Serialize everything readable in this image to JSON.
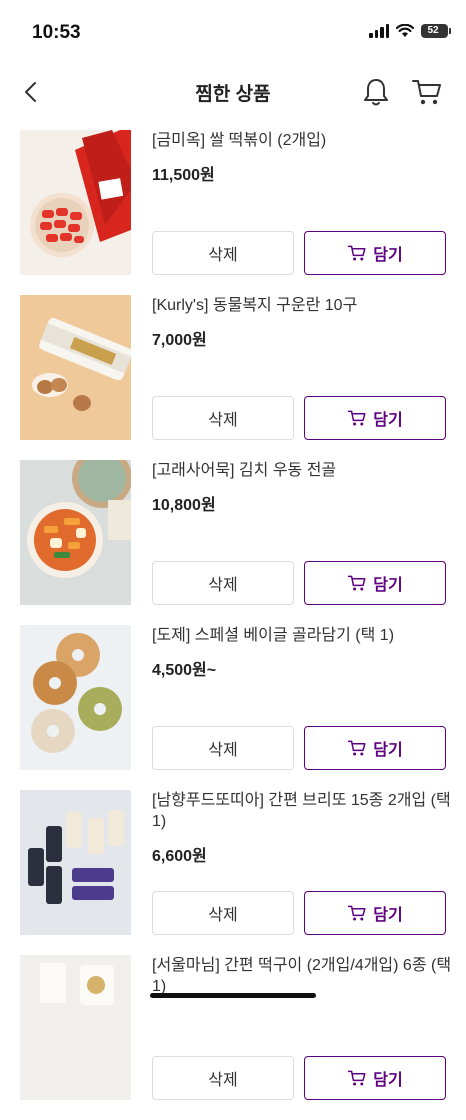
{
  "status_bar": {
    "time": "10:53",
    "battery": "52"
  },
  "header": {
    "title": "찜한 상품",
    "icons": [
      "back-arrow-icon",
      "bell-icon",
      "cart-icon"
    ]
  },
  "accent_color": "#5f0080",
  "products": [
    {
      "name": "[금미옥] 쌀 떡볶이 (2개입)",
      "price": "11,500원",
      "delete_label": "삭제",
      "add_label": "담기"
    },
    {
      "name": "[Kurly's] 동물복지 구운란 10구",
      "price": "7,000원",
      "delete_label": "삭제",
      "add_label": "담기"
    },
    {
      "name": "[고래사어묵] 김치 우동 전골",
      "price": "10,800원",
      "delete_label": "삭제",
      "add_label": "담기"
    },
    {
      "name": "[도제] 스페셜 베이글 골라담기 (택 1)",
      "price": "4,500원~",
      "delete_label": "삭제",
      "add_label": "담기"
    },
    {
      "name": "[남향푸드또띠아] 간편 브리또 15종 2개입 (택1)",
      "price": "6,600원",
      "delete_label": "삭제",
      "add_label": "담기"
    },
    {
      "name": "[서울마님] 간편 떡구이 (2개입/4개입) 6종 (택1)",
      "price": "",
      "delete_label": "삭제",
      "add_label": "담기"
    }
  ]
}
